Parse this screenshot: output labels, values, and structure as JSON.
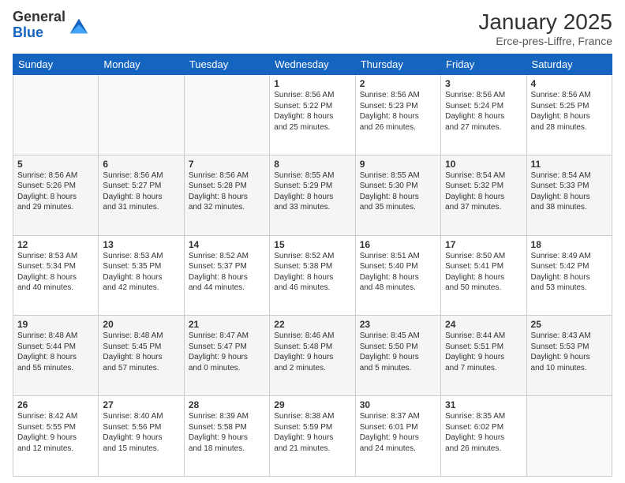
{
  "logo": {
    "general": "General",
    "blue": "Blue"
  },
  "title": "January 2025",
  "location": "Erce-pres-Liffre, France",
  "days_of_week": [
    "Sunday",
    "Monday",
    "Tuesday",
    "Wednesday",
    "Thursday",
    "Friday",
    "Saturday"
  ],
  "weeks": [
    [
      {
        "day": "",
        "info": ""
      },
      {
        "day": "",
        "info": ""
      },
      {
        "day": "",
        "info": ""
      },
      {
        "day": "1",
        "info": "Sunrise: 8:56 AM\nSunset: 5:22 PM\nDaylight: 8 hours\nand 25 minutes."
      },
      {
        "day": "2",
        "info": "Sunrise: 8:56 AM\nSunset: 5:23 PM\nDaylight: 8 hours\nand 26 minutes."
      },
      {
        "day": "3",
        "info": "Sunrise: 8:56 AM\nSunset: 5:24 PM\nDaylight: 8 hours\nand 27 minutes."
      },
      {
        "day": "4",
        "info": "Sunrise: 8:56 AM\nSunset: 5:25 PM\nDaylight: 8 hours\nand 28 minutes."
      }
    ],
    [
      {
        "day": "5",
        "info": "Sunrise: 8:56 AM\nSunset: 5:26 PM\nDaylight: 8 hours\nand 29 minutes."
      },
      {
        "day": "6",
        "info": "Sunrise: 8:56 AM\nSunset: 5:27 PM\nDaylight: 8 hours\nand 31 minutes."
      },
      {
        "day": "7",
        "info": "Sunrise: 8:56 AM\nSunset: 5:28 PM\nDaylight: 8 hours\nand 32 minutes."
      },
      {
        "day": "8",
        "info": "Sunrise: 8:55 AM\nSunset: 5:29 PM\nDaylight: 8 hours\nand 33 minutes."
      },
      {
        "day": "9",
        "info": "Sunrise: 8:55 AM\nSunset: 5:30 PM\nDaylight: 8 hours\nand 35 minutes."
      },
      {
        "day": "10",
        "info": "Sunrise: 8:54 AM\nSunset: 5:32 PM\nDaylight: 8 hours\nand 37 minutes."
      },
      {
        "day": "11",
        "info": "Sunrise: 8:54 AM\nSunset: 5:33 PM\nDaylight: 8 hours\nand 38 minutes."
      }
    ],
    [
      {
        "day": "12",
        "info": "Sunrise: 8:53 AM\nSunset: 5:34 PM\nDaylight: 8 hours\nand 40 minutes."
      },
      {
        "day": "13",
        "info": "Sunrise: 8:53 AM\nSunset: 5:35 PM\nDaylight: 8 hours\nand 42 minutes."
      },
      {
        "day": "14",
        "info": "Sunrise: 8:52 AM\nSunset: 5:37 PM\nDaylight: 8 hours\nand 44 minutes."
      },
      {
        "day": "15",
        "info": "Sunrise: 8:52 AM\nSunset: 5:38 PM\nDaylight: 8 hours\nand 46 minutes."
      },
      {
        "day": "16",
        "info": "Sunrise: 8:51 AM\nSunset: 5:40 PM\nDaylight: 8 hours\nand 48 minutes."
      },
      {
        "day": "17",
        "info": "Sunrise: 8:50 AM\nSunset: 5:41 PM\nDaylight: 8 hours\nand 50 minutes."
      },
      {
        "day": "18",
        "info": "Sunrise: 8:49 AM\nSunset: 5:42 PM\nDaylight: 8 hours\nand 53 minutes."
      }
    ],
    [
      {
        "day": "19",
        "info": "Sunrise: 8:48 AM\nSunset: 5:44 PM\nDaylight: 8 hours\nand 55 minutes."
      },
      {
        "day": "20",
        "info": "Sunrise: 8:48 AM\nSunset: 5:45 PM\nDaylight: 8 hours\nand 57 minutes."
      },
      {
        "day": "21",
        "info": "Sunrise: 8:47 AM\nSunset: 5:47 PM\nDaylight: 9 hours\nand 0 minutes."
      },
      {
        "day": "22",
        "info": "Sunrise: 8:46 AM\nSunset: 5:48 PM\nDaylight: 9 hours\nand 2 minutes."
      },
      {
        "day": "23",
        "info": "Sunrise: 8:45 AM\nSunset: 5:50 PM\nDaylight: 9 hours\nand 5 minutes."
      },
      {
        "day": "24",
        "info": "Sunrise: 8:44 AM\nSunset: 5:51 PM\nDaylight: 9 hours\nand 7 minutes."
      },
      {
        "day": "25",
        "info": "Sunrise: 8:43 AM\nSunset: 5:53 PM\nDaylight: 9 hours\nand 10 minutes."
      }
    ],
    [
      {
        "day": "26",
        "info": "Sunrise: 8:42 AM\nSunset: 5:55 PM\nDaylight: 9 hours\nand 12 minutes."
      },
      {
        "day": "27",
        "info": "Sunrise: 8:40 AM\nSunset: 5:56 PM\nDaylight: 9 hours\nand 15 minutes."
      },
      {
        "day": "28",
        "info": "Sunrise: 8:39 AM\nSunset: 5:58 PM\nDaylight: 9 hours\nand 18 minutes."
      },
      {
        "day": "29",
        "info": "Sunrise: 8:38 AM\nSunset: 5:59 PM\nDaylight: 9 hours\nand 21 minutes."
      },
      {
        "day": "30",
        "info": "Sunrise: 8:37 AM\nSunset: 6:01 PM\nDaylight: 9 hours\nand 24 minutes."
      },
      {
        "day": "31",
        "info": "Sunrise: 8:35 AM\nSunset: 6:02 PM\nDaylight: 9 hours\nand 26 minutes."
      },
      {
        "day": "",
        "info": ""
      }
    ]
  ]
}
